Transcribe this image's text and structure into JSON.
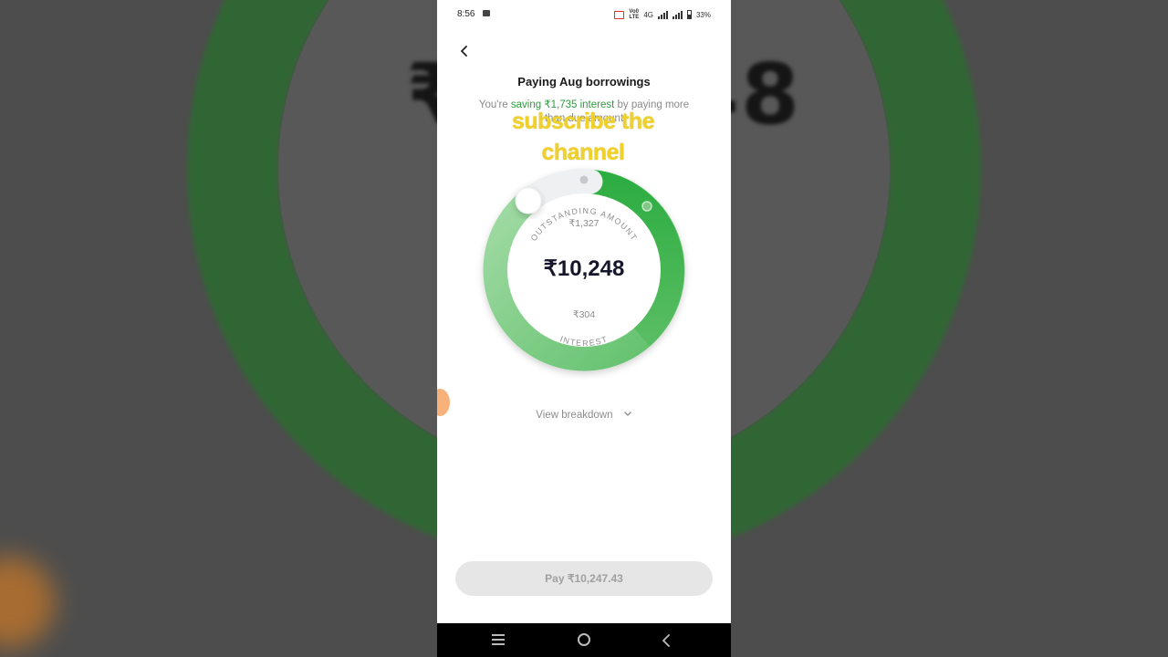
{
  "background": {
    "blurred_amount": "₹10,248"
  },
  "status_bar": {
    "time": "8:56",
    "network_top": "Vo0",
    "network_bottom": "LTE",
    "network_type": "4G",
    "battery": "33%"
  },
  "header": {
    "title": "Paying Aug borrowings",
    "subtitle_prefix": "You're ",
    "subtitle_highlight": "saving ₹1,735 interest",
    "subtitle_suffix": " by paying more than due amount"
  },
  "overlay": {
    "line1": "subscribe the",
    "line2": "channel"
  },
  "dial": {
    "total_amount": "₹10,248",
    "outstanding_label": "OUTSTANDING AMOUNT",
    "outstanding_value": "₹1,327",
    "interest_label": "INTEREST",
    "interest_value": "₹304",
    "colors": {
      "green_dark": "#35b548",
      "green_light": "#a8ddab",
      "track": "#eef0f2"
    }
  },
  "breakdown": {
    "label": "View breakdown",
    "icon": "chevron-down-icon"
  },
  "pay_button": {
    "label": "Pay ₹10,247.43"
  },
  "nav": {
    "icons": [
      "menu-icon",
      "home-icon",
      "back-icon"
    ]
  }
}
